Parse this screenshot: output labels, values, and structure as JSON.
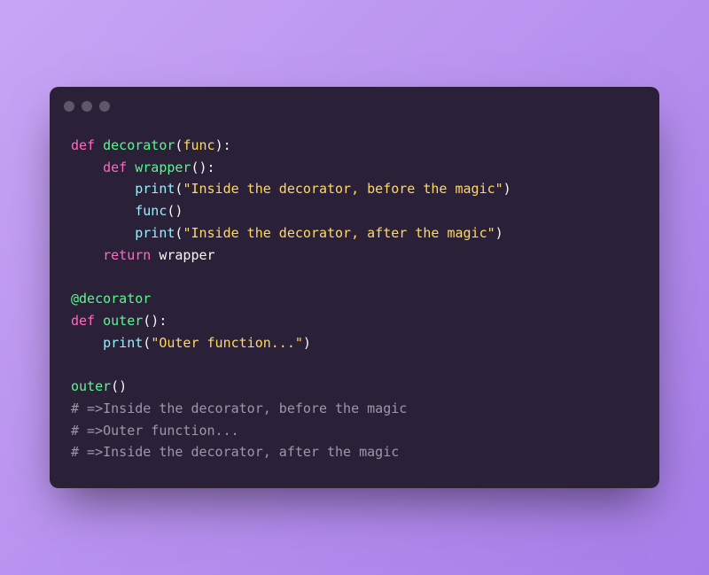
{
  "code": {
    "lines": [
      {
        "tokens": [
          {
            "t": "def",
            "c": "kw"
          },
          {
            "t": " ",
            "c": ""
          },
          {
            "t": "decorator",
            "c": "fn"
          },
          {
            "t": "(",
            "c": "punct"
          },
          {
            "t": "func",
            "c": "param"
          },
          {
            "t": "):",
            "c": "punct"
          }
        ]
      },
      {
        "tokens": [
          {
            "t": "    ",
            "c": ""
          },
          {
            "t": "def",
            "c": "kw"
          },
          {
            "t": " ",
            "c": ""
          },
          {
            "t": "wrapper",
            "c": "fn"
          },
          {
            "t": "():",
            "c": "punct"
          }
        ]
      },
      {
        "tokens": [
          {
            "t": "        ",
            "c": ""
          },
          {
            "t": "print",
            "c": "call"
          },
          {
            "t": "(",
            "c": "punct"
          },
          {
            "t": "\"Inside the decorator, before the magic\"",
            "c": "str"
          },
          {
            "t": ")",
            "c": "punct"
          }
        ]
      },
      {
        "tokens": [
          {
            "t": "        ",
            "c": ""
          },
          {
            "t": "func",
            "c": "call"
          },
          {
            "t": "()",
            "c": "punct"
          }
        ]
      },
      {
        "tokens": [
          {
            "t": "        ",
            "c": ""
          },
          {
            "t": "print",
            "c": "call"
          },
          {
            "t": "(",
            "c": "punct"
          },
          {
            "t": "\"Inside the decorator, after the magic\"",
            "c": "str"
          },
          {
            "t": ")",
            "c": "punct"
          }
        ]
      },
      {
        "tokens": [
          {
            "t": "    ",
            "c": ""
          },
          {
            "t": "return",
            "c": "kw"
          },
          {
            "t": " wrapper",
            "c": "punct"
          }
        ]
      },
      {
        "tokens": [
          {
            "t": "",
            "c": ""
          }
        ]
      },
      {
        "tokens": [
          {
            "t": "@decorator",
            "c": "at"
          }
        ]
      },
      {
        "tokens": [
          {
            "t": "def",
            "c": "kw"
          },
          {
            "t": " ",
            "c": ""
          },
          {
            "t": "outer",
            "c": "fn"
          },
          {
            "t": "():",
            "c": "punct"
          }
        ]
      },
      {
        "tokens": [
          {
            "t": "    ",
            "c": ""
          },
          {
            "t": "print",
            "c": "call"
          },
          {
            "t": "(",
            "c": "punct"
          },
          {
            "t": "\"Outer function...\"",
            "c": "str"
          },
          {
            "t": ")",
            "c": "punct"
          }
        ]
      },
      {
        "tokens": [
          {
            "t": "",
            "c": ""
          }
        ]
      },
      {
        "tokens": [
          {
            "t": "outer",
            "c": "fn"
          },
          {
            "t": "()",
            "c": "punct"
          }
        ]
      },
      {
        "tokens": [
          {
            "t": "# =>Inside the decorator, before the magic",
            "c": "comment"
          }
        ]
      },
      {
        "tokens": [
          {
            "t": "# =>Outer function...",
            "c": "comment"
          }
        ]
      },
      {
        "tokens": [
          {
            "t": "# =>Inside the decorator, after the magic",
            "c": "comment"
          }
        ]
      }
    ]
  }
}
